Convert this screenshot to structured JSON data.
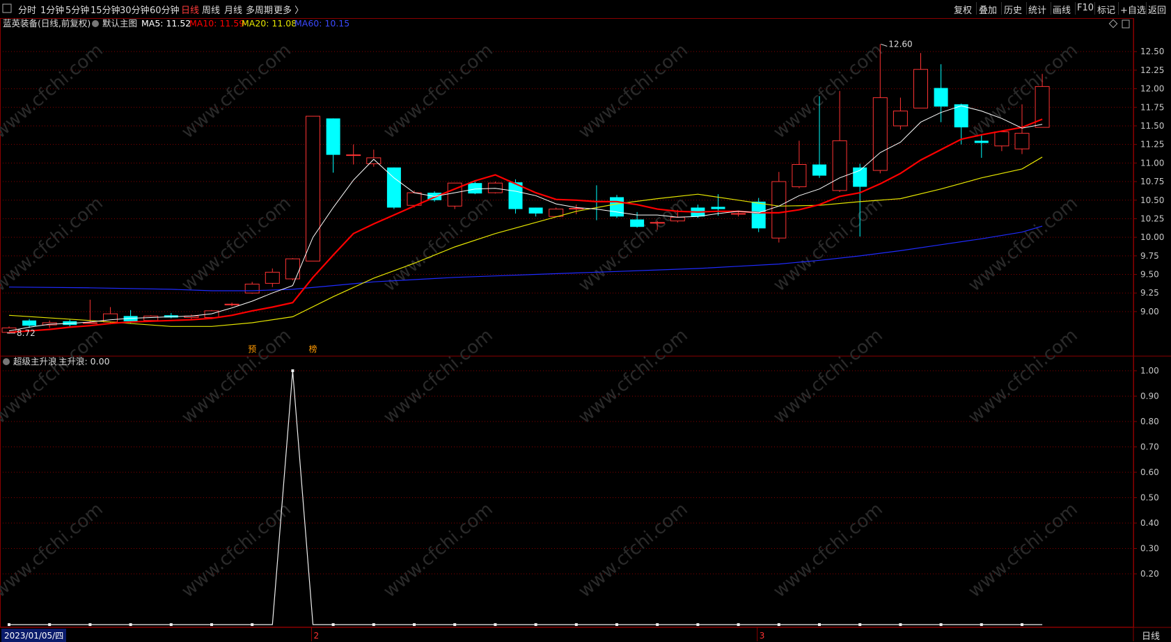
{
  "toolbar": {
    "periods": [
      "分时",
      "1分钟",
      "5分钟",
      "15分钟",
      "30分钟",
      "60分钟",
      "日线",
      "周线",
      "月线",
      "多周期",
      "更多 〉"
    ],
    "active_period": "日线",
    "right_buttons": [
      "复权",
      "叠加",
      "历史",
      "统计",
      "画线",
      "F10",
      "标记",
      "+自选",
      "返回"
    ]
  },
  "main_legend": {
    "stock": "蓝英装备(日线,前复权)",
    "chart_name": "默认主图",
    "ma5": "MA5: 11.52",
    "ma10": "MA10: 11.59",
    "ma20": "MA20: 11.08",
    "ma60": "MA60: 10.15"
  },
  "indicator_legend": {
    "name": "超级主升浪",
    "value": "主升浪: 0.00"
  },
  "bottom": {
    "date": "2023/01/05/四",
    "period": "日线",
    "month_markers": [
      "2",
      "3"
    ]
  },
  "watermark": "www.cfchi.com",
  "annotations": {
    "high_label": "12.60",
    "low_label": "8.72",
    "tag1": "预",
    "tag2": "榜"
  },
  "colors": {
    "up": "#ff3333",
    "down": "#00ffff",
    "ma5": "#ffffff",
    "ma10": "#ff0000",
    "ma20": "#e6e600",
    "ma60": "#1f2bff",
    "grid": "#8b0000",
    "axis_text": "#c8c8c8"
  },
  "chart_data": {
    "type": "candlestick",
    "price_axis": {
      "ticks": [
        9.0,
        9.25,
        9.5,
        9.75,
        10.0,
        10.25,
        10.5,
        10.75,
        11.0,
        11.25,
        11.5,
        11.75,
        12.0,
        12.25,
        12.5
      ],
      "ylim": [
        8.55,
        12.82
      ]
    },
    "indicator_axis": {
      "ticks": [
        0.2,
        0.3,
        0.4,
        0.5,
        0.6,
        0.7,
        0.8,
        0.9,
        1.0
      ],
      "ylim": [
        0.0,
        1.0
      ]
    },
    "candles": [
      {
        "o": 8.72,
        "c": 8.78,
        "h": 8.8,
        "l": 8.7
      },
      {
        "o": 8.88,
        "c": 8.81,
        "h": 8.9,
        "l": 8.78
      },
      {
        "o": 8.82,
        "c": 8.85,
        "h": 8.88,
        "l": 8.78
      },
      {
        "o": 8.87,
        "c": 8.82,
        "h": 8.89,
        "l": 8.8
      },
      {
        "o": 8.85,
        "c": 8.85,
        "h": 9.16,
        "l": 8.84
      },
      {
        "o": 8.86,
        "c": 8.97,
        "h": 9.06,
        "l": 8.83
      },
      {
        "o": 8.94,
        "c": 8.87,
        "h": 9.02,
        "l": 8.84
      },
      {
        "o": 8.88,
        "c": 8.94,
        "h": 8.95,
        "l": 8.86
      },
      {
        "o": 8.95,
        "c": 8.92,
        "h": 8.98,
        "l": 8.91
      },
      {
        "o": 8.92,
        "c": 8.94,
        "h": 8.96,
        "l": 8.9
      },
      {
        "o": 8.92,
        "c": 9.01,
        "h": 9.02,
        "l": 8.9
      },
      {
        "o": 9.09,
        "c": 9.1,
        "h": 9.12,
        "l": 9.07
      },
      {
        "o": 9.25,
        "c": 9.37,
        "h": 9.4,
        "l": 9.24
      },
      {
        "o": 9.38,
        "c": 9.53,
        "h": 9.58,
        "l": 9.33
      },
      {
        "o": 9.44,
        "c": 9.71,
        "h": 9.72,
        "l": 9.42
      },
      {
        "o": 9.68,
        "c": 11.63,
        "h": 11.63,
        "l": 9.68
      },
      {
        "o": 11.6,
        "c": 11.11,
        "h": 11.6,
        "l": 10.87
      },
      {
        "o": 11.11,
        "c": 11.11,
        "h": 11.25,
        "l": 10.98
      },
      {
        "o": 10.99,
        "c": 11.07,
        "h": 11.18,
        "l": 10.95
      },
      {
        "o": 10.94,
        "c": 10.4,
        "h": 10.94,
        "l": 10.38
      },
      {
        "o": 10.43,
        "c": 10.6,
        "h": 10.63,
        "l": 10.4
      },
      {
        "o": 10.6,
        "c": 10.5,
        "h": 10.62,
        "l": 10.48
      },
      {
        "o": 10.42,
        "c": 10.73,
        "h": 10.73,
        "l": 10.38
      },
      {
        "o": 10.73,
        "c": 10.59,
        "h": 10.75,
        "l": 10.58
      },
      {
        "o": 10.6,
        "c": 10.73,
        "h": 10.75,
        "l": 10.59
      },
      {
        "o": 10.74,
        "c": 10.38,
        "h": 10.78,
        "l": 10.32
      },
      {
        "o": 10.4,
        "c": 10.32,
        "h": 10.4,
        "l": 10.28
      },
      {
        "o": 10.28,
        "c": 10.38,
        "h": 10.4,
        "l": 10.27
      },
      {
        "o": 10.38,
        "c": 10.39,
        "h": 10.44,
        "l": 10.31
      },
      {
        "o": 10.49,
        "c": 10.48,
        "h": 10.7,
        "l": 10.23
      },
      {
        "o": 10.54,
        "c": 10.28,
        "h": 10.57,
        "l": 10.26
      },
      {
        "o": 10.24,
        "c": 10.14,
        "h": 10.34,
        "l": 10.13
      },
      {
        "o": 10.19,
        "c": 10.2,
        "h": 10.22,
        "l": 10.1
      },
      {
        "o": 10.22,
        "c": 10.27,
        "h": 10.37,
        "l": 10.2
      },
      {
        "o": 10.4,
        "c": 10.28,
        "h": 10.44,
        "l": 10.26
      },
      {
        "o": 10.41,
        "c": 10.38,
        "h": 10.58,
        "l": 10.29
      },
      {
        "o": 10.32,
        "c": 10.32,
        "h": 10.36,
        "l": 10.28
      },
      {
        "o": 10.48,
        "c": 10.12,
        "h": 10.53,
        "l": 10.07
      },
      {
        "o": 9.99,
        "c": 10.75,
        "h": 10.88,
        "l": 9.93
      },
      {
        "o": 10.68,
        "c": 10.98,
        "h": 11.3,
        "l": 10.66
      },
      {
        "o": 10.98,
        "c": 10.83,
        "h": 11.9,
        "l": 10.8
      },
      {
        "o": 10.63,
        "c": 11.3,
        "h": 11.97,
        "l": 10.61
      },
      {
        "o": 10.94,
        "c": 10.68,
        "h": 10.99,
        "l": 10.01
      },
      {
        "o": 10.9,
        "c": 11.88,
        "h": 12.6,
        "l": 10.86
      },
      {
        "o": 11.5,
        "c": 11.7,
        "h": 11.88,
        "l": 11.45
      },
      {
        "o": 11.74,
        "c": 12.26,
        "h": 12.48,
        "l": 11.74
      },
      {
        "o": 12.01,
        "c": 11.76,
        "h": 12.33,
        "l": 11.55
      },
      {
        "o": 11.79,
        "c": 11.48,
        "h": 11.8,
        "l": 11.25
      },
      {
        "o": 11.3,
        "c": 11.27,
        "h": 11.38,
        "l": 11.07
      },
      {
        "o": 11.23,
        "c": 11.42,
        "h": 11.43,
        "l": 11.16
      },
      {
        "o": 11.19,
        "c": 11.4,
        "h": 11.79,
        "l": 11.12
      },
      {
        "o": 11.48,
        "c": 12.03,
        "h": 12.2,
        "l": 11.48
      }
    ],
    "ma5": [
      [
        0,
        8.74
      ],
      [
        1,
        8.79
      ],
      [
        2,
        8.83
      ],
      [
        3,
        8.84
      ],
      [
        4,
        8.86
      ],
      [
        5,
        8.89
      ],
      [
        6,
        8.91
      ],
      [
        7,
        8.92
      ],
      [
        8,
        8.93
      ],
      [
        9,
        8.94
      ],
      [
        10,
        8.97
      ],
      [
        11,
        9.05
      ],
      [
        12,
        9.14
      ],
      [
        13,
        9.25
      ],
      [
        14,
        9.35
      ],
      [
        15,
        10.0
      ],
      [
        16,
        10.4
      ],
      [
        17,
        10.77
      ],
      [
        18,
        11.05
      ],
      [
        19,
        10.8
      ],
      [
        20,
        10.6
      ],
      [
        21,
        10.55
      ],
      [
        22,
        10.6
      ],
      [
        23,
        10.65
      ],
      [
        24,
        10.66
      ],
      [
        25,
        10.62
      ],
      [
        26,
        10.56
      ],
      [
        27,
        10.45
      ],
      [
        28,
        10.4
      ],
      [
        29,
        10.38
      ],
      [
        30,
        10.34
      ],
      [
        31,
        10.3
      ],
      [
        32,
        10.3
      ],
      [
        33,
        10.27
      ],
      [
        34,
        10.28
      ],
      [
        35,
        10.32
      ],
      [
        36,
        10.35
      ],
      [
        37,
        10.33
      ],
      [
        38,
        10.42
      ],
      [
        39,
        10.56
      ],
      [
        40,
        10.65
      ],
      [
        41,
        10.8
      ],
      [
        42,
        10.9
      ],
      [
        43,
        11.14
      ],
      [
        44,
        11.28
      ],
      [
        45,
        11.55
      ],
      [
        46,
        11.68
      ],
      [
        47,
        11.77
      ],
      [
        48,
        11.7
      ],
      [
        49,
        11.6
      ],
      [
        50,
        11.47
      ],
      [
        51,
        11.52
      ]
    ],
    "ma10": [
      [
        0,
        8.72
      ],
      [
        1,
        8.74
      ],
      [
        2,
        8.76
      ],
      [
        3,
        8.79
      ],
      [
        4,
        8.81
      ],
      [
        5,
        8.84
      ],
      [
        6,
        8.86
      ],
      [
        7,
        8.87
      ],
      [
        8,
        8.88
      ],
      [
        9,
        8.89
      ],
      [
        10,
        8.91
      ],
      [
        11,
        8.95
      ],
      [
        12,
        9.01
      ],
      [
        13,
        9.06
      ],
      [
        14,
        9.12
      ],
      [
        15,
        9.46
      ],
      [
        16,
        9.76
      ],
      [
        17,
        10.05
      ],
      [
        18,
        10.18
      ],
      [
        19,
        10.3
      ],
      [
        20,
        10.42
      ],
      [
        21,
        10.54
      ],
      [
        22,
        10.65
      ],
      [
        23,
        10.76
      ],
      [
        24,
        10.84
      ],
      [
        25,
        10.72
      ],
      [
        26,
        10.6
      ],
      [
        27,
        10.51
      ],
      [
        28,
        10.5
      ],
      [
        29,
        10.48
      ],
      [
        30,
        10.48
      ],
      [
        31,
        10.44
      ],
      [
        32,
        10.38
      ],
      [
        33,
        10.35
      ],
      [
        34,
        10.34
      ],
      [
        35,
        10.35
      ],
      [
        36,
        10.35
      ],
      [
        37,
        10.33
      ],
      [
        38,
        10.33
      ],
      [
        39,
        10.37
      ],
      [
        40,
        10.44
      ],
      [
        41,
        10.55
      ],
      [
        42,
        10.6
      ],
      [
        43,
        10.72
      ],
      [
        44,
        10.86
      ],
      [
        45,
        11.04
      ],
      [
        46,
        11.18
      ],
      [
        47,
        11.32
      ],
      [
        48,
        11.38
      ],
      [
        49,
        11.43
      ],
      [
        50,
        11.48
      ],
      [
        51,
        11.59
      ]
    ],
    "ma20": [
      [
        0,
        8.95
      ],
      [
        4,
        8.88
      ],
      [
        8,
        8.8
      ],
      [
        10,
        8.8
      ],
      [
        12,
        8.85
      ],
      [
        14,
        8.93
      ],
      [
        16,
        9.2
      ],
      [
        18,
        9.45
      ],
      [
        20,
        9.65
      ],
      [
        22,
        9.87
      ],
      [
        24,
        10.05
      ],
      [
        26,
        10.2
      ],
      [
        28,
        10.35
      ],
      [
        30,
        10.45
      ],
      [
        32,
        10.52
      ],
      [
        34,
        10.58
      ],
      [
        36,
        10.5
      ],
      [
        38,
        10.42
      ],
      [
        40,
        10.43
      ],
      [
        42,
        10.48
      ],
      [
        44,
        10.52
      ],
      [
        46,
        10.65
      ],
      [
        48,
        10.8
      ],
      [
        50,
        10.92
      ],
      [
        51,
        11.08
      ]
    ],
    "ma60": [
      [
        0,
        9.33
      ],
      [
        4,
        9.32
      ],
      [
        8,
        9.3
      ],
      [
        10,
        9.28
      ],
      [
        12,
        9.28
      ],
      [
        14,
        9.3
      ],
      [
        16,
        9.35
      ],
      [
        18,
        9.4
      ],
      [
        20,
        9.43
      ],
      [
        22,
        9.46
      ],
      [
        24,
        9.48
      ],
      [
        26,
        9.5
      ],
      [
        28,
        9.52
      ],
      [
        30,
        9.54
      ],
      [
        32,
        9.56
      ],
      [
        34,
        9.58
      ],
      [
        36,
        9.61
      ],
      [
        38,
        9.64
      ],
      [
        40,
        9.69
      ],
      [
        42,
        9.75
      ],
      [
        44,
        9.82
      ],
      [
        46,
        9.9
      ],
      [
        48,
        9.98
      ],
      [
        50,
        10.07
      ],
      [
        51,
        10.15
      ]
    ],
    "indicator": {
      "name": "主升浪",
      "values_peak_index": 14,
      "peak_value": 1.0,
      "baseline": 0.0
    }
  }
}
